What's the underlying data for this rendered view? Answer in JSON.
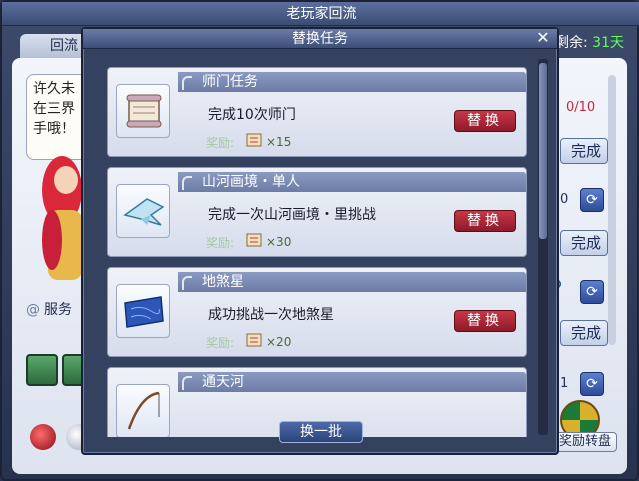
{
  "background": {
    "title": "老玩家回流",
    "tab_label": "回流",
    "remaining_label": "剩余:",
    "remaining_days": "31天",
    "speech_lines": [
      "许久未",
      "在三界",
      "手哦！"
    ],
    "service_label": "服务",
    "progress_count": "0/10",
    "complete_label": "完成",
    "wheel_label": "奖励转盘",
    "small_numbers": [
      "0",
      "1"
    ]
  },
  "modal": {
    "title": "替换任务",
    "close_glyph": "✕",
    "reward_label": "奖励:",
    "replace_label": "替换",
    "footer_button": "换一批",
    "tasks": [
      {
        "title": "师门任务",
        "description": "完成10次师门",
        "reward_qty": "×15",
        "icon": "scroll-icon"
      },
      {
        "title": "山河画境・单人",
        "description": "完成一次山河画境・里挑战",
        "reward_qty": "×30",
        "icon": "paper-crane-icon"
      },
      {
        "title": "地煞星",
        "description": "成功挑战一次地煞星",
        "reward_qty": "×20",
        "icon": "blue-map-icon"
      },
      {
        "title": "通天河",
        "description": "",
        "reward_qty": "",
        "icon": "fishing-rod-icon"
      }
    ]
  },
  "colors": {
    "replace_button": "#b0283a",
    "accent_green": "#5cff5c",
    "header_blue": "#7c8cb4"
  }
}
